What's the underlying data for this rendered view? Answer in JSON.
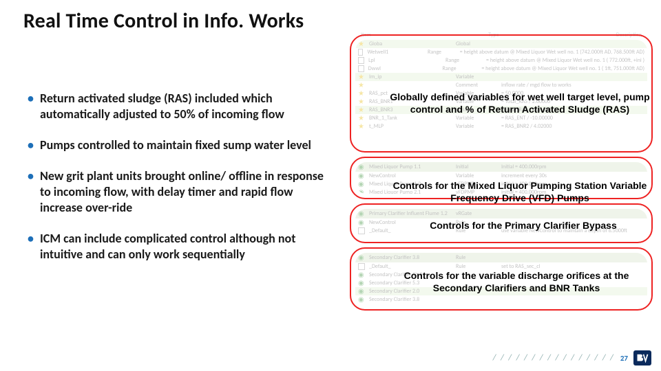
{
  "title": "Real Time Control in Info. Works",
  "bullets": [
    "Return activated sludge (RAS) included which automatically adjusted to 50% of incoming flow",
    "Pumps controlled to maintain fixed sump water level",
    "New grit plant units brought online/ offline in response to incoming flow, with delay timer and rapid flow increase over-ride",
    "ICM can include complicated control although not intuitive and can only work sequentially"
  ],
  "callouts": {
    "c1": "Globally defined variables for wet well target level, pump control and % of Return Activated Sludge (RAS)",
    "c2": "Controls for the Mixed Liquor Pumping Station Variable Frequency Drive (VFD) Pumps",
    "c3": "Controls for the Primary Clarifier Bypass",
    "c4": "Controls for the variable discharge orifices at the Secondary Clarifiers and BNR Tanks"
  },
  "panel_header": {
    "col1": "Item",
    "col2": "Type",
    "col3": "Description"
  },
  "panel1_rows": [
    {
      "icon": "star",
      "name": "Globa",
      "type": "Global",
      "desc": ""
    },
    {
      "icon": "box",
      "name": "Wetwell1",
      "type": "Range",
      "desc": "= height above datum @ Mixed Liquor Wet well no. 1 (742.000ft AD, 768.500ft AD)"
    },
    {
      "icon": "box",
      "name": "Lpl",
      "type": "Range",
      "desc": "= height above datum @ Mixed Liquor Wet well no. 1 ( 772.000ft, +ini )"
    },
    {
      "icon": "box",
      "name": "Dwwl",
      "type": "Range",
      "desc": "= height above datum @ Mixed Liquor Wet well no. 1 ( 1ft, 751.000ft AD)"
    },
    {
      "icon": "star",
      "name": "Im_ip",
      "type": "Variable",
      "desc": ""
    },
    {
      "icon": "star",
      "name": "",
      "type": "Comment",
      "desc": "inflow rate / mgd flow to works"
    },
    {
      "icon": "star",
      "name": "RAS_pct",
      "type": "Variable",
      "desc": "= 50.0000"
    },
    {
      "icon": "star",
      "name": "RAS_BNR1",
      "type": "Variable",
      "desc": "= Total_RAS / 2.00000"
    },
    {
      "icon": "star",
      "name": "RAS_BNR3",
      "type": "Variable",
      "desc": "= Total_RAS - RAS_BNR1"
    },
    {
      "icon": "star",
      "name": "BNR_1_Tank",
      "type": "Variable",
      "desc": "= RAS_ENT / -10.00000"
    },
    {
      "icon": "star",
      "name": "t_MLP",
      "type": "Variable",
      "desc": "= RAS_BNR2 / 4.02000"
    }
  ],
  "panel2_rows": [
    {
      "icon": "dot",
      "name": "Mixed Liquor Pump 1.1",
      "type": "Initial",
      "desc": "Initial = 400.000rpm"
    },
    {
      "icon": "dot",
      "name": "NewControl",
      "type": "Variable",
      "desc": "increment every 30s"
    },
    {
      "icon": "dot",
      "name": "Mixed Liquor Pump 1.2",
      "type": "vFDPMP",
      "desc": "initial = 400.000rpm"
    },
    {
      "icon": "dot",
      "name": "Mixed Liquor Pump 2.1",
      "type": "vFDPMP",
      "desc": "initial = 400.000rpm"
    }
  ],
  "panel3_rows": [
    {
      "icon": "dot",
      "name": "Primary Clarifier Influent Flume 1.2",
      "type": "vRGate",
      "desc": ""
    },
    {
      "icon": "dot",
      "name": "NewControl",
      "type": "Rule",
      "desc": ""
    },
    {
      "icon": "box",
      "name": "_Default_",
      "type": "Rule",
      "desc": "use variable NewControl to maintain a depth of 6.5000ft"
    }
  ],
  "panel4_rows": [
    {
      "icon": "dot",
      "name": "Secondary Clarifier 3.8",
      "type": "Rule",
      "desc": ""
    },
    {
      "icon": "box",
      "name": "_Default_",
      "type": "Rule",
      "desc": "set to RAS_sec_cl"
    },
    {
      "icon": "dot",
      "name": "Secondary Clarifier 1b.3",
      "type": "",
      "desc": ""
    },
    {
      "icon": "dot",
      "name": "Secondary Clarifier 5.3",
      "type": "",
      "desc": ""
    },
    {
      "icon": "dot",
      "name": "Secondary Clarifier 2.0",
      "type": "",
      "desc": ""
    },
    {
      "icon": "dot",
      "name": "Secondary Clarifier 3.8",
      "type": "",
      "desc": ""
    }
  ],
  "page_number": "27",
  "logo_label": "BV"
}
